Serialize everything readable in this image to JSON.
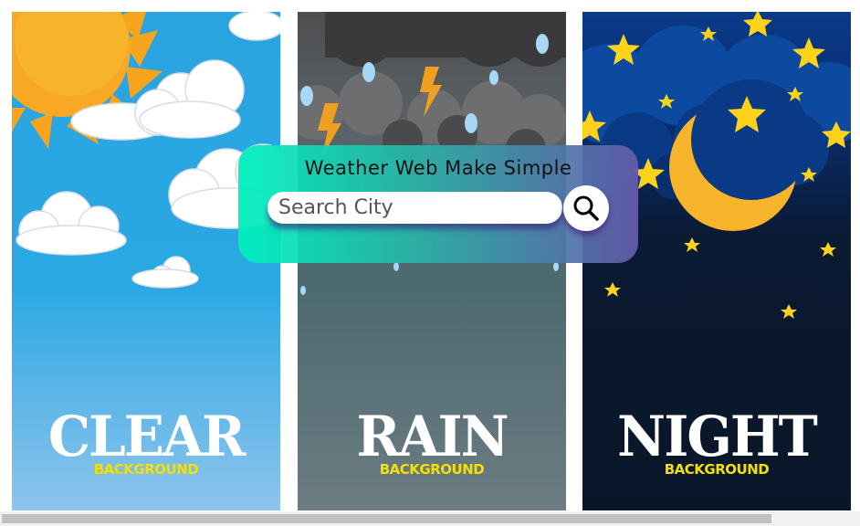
{
  "app": {
    "title": "Weather Web Make Simple"
  },
  "search": {
    "placeholder": "Search City",
    "value": ""
  },
  "panels": [
    {
      "word": "CLEAR",
      "subword": "BACKGROUND"
    },
    {
      "word": "RAIN",
      "subword": "BACKGROUND"
    },
    {
      "word": "NIGHT",
      "subword": "BACKGROUND"
    }
  ],
  "icons": {
    "search_button": "search-icon"
  },
  "colors": {
    "label_yellow": "#f5e000",
    "card_start": "#00f0be",
    "card_end": "#645aaa"
  }
}
